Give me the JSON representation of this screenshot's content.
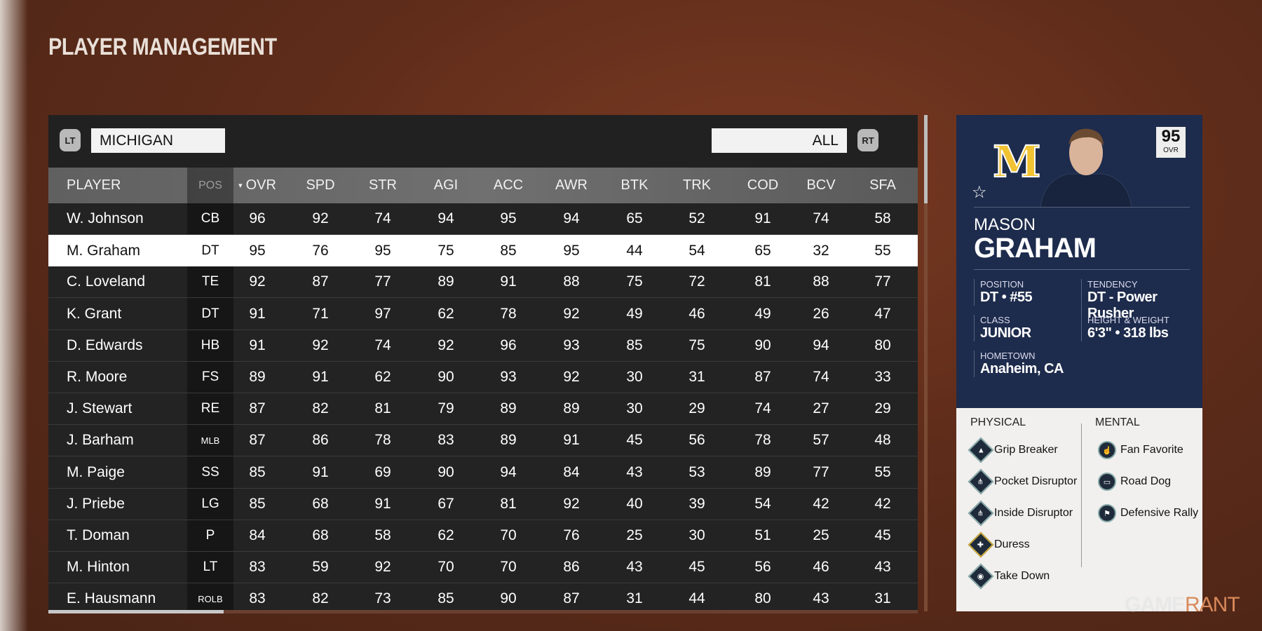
{
  "page_title": "PLAYER MANAGEMENT",
  "filters": {
    "left_bumper": "LT",
    "team": "MICHIGAN",
    "position_filter": "ALL",
    "right_bumper": "RT"
  },
  "table": {
    "columns": [
      "PLAYER",
      "POS",
      "OVR",
      "SPD",
      "STR",
      "AGI",
      "ACC",
      "AWR",
      "BTK",
      "TRK",
      "COD",
      "BCV",
      "SFA"
    ],
    "sort_column": "OVR",
    "sort_indicator": "▾",
    "selected_row": 1,
    "rows": [
      {
        "player": "W. Johnson",
        "pos": "CB",
        "stats": [
          96,
          92,
          74,
          94,
          95,
          94,
          65,
          52,
          91,
          74,
          58
        ]
      },
      {
        "player": "M. Graham",
        "pos": "DT",
        "stats": [
          95,
          76,
          95,
          75,
          85,
          95,
          44,
          54,
          65,
          32,
          55
        ]
      },
      {
        "player": "C. Loveland",
        "pos": "TE",
        "stats": [
          92,
          87,
          77,
          89,
          91,
          88,
          75,
          72,
          81,
          88,
          77
        ]
      },
      {
        "player": "K. Grant",
        "pos": "DT",
        "stats": [
          91,
          71,
          97,
          62,
          78,
          92,
          49,
          46,
          49,
          26,
          47
        ]
      },
      {
        "player": "D. Edwards",
        "pos": "HB",
        "stats": [
          91,
          92,
          74,
          92,
          96,
          93,
          85,
          75,
          90,
          94,
          80
        ]
      },
      {
        "player": "R. Moore",
        "pos": "FS",
        "stats": [
          89,
          91,
          62,
          90,
          93,
          92,
          30,
          31,
          87,
          74,
          33
        ]
      },
      {
        "player": "J. Stewart",
        "pos": "RE",
        "stats": [
          87,
          82,
          81,
          79,
          89,
          89,
          30,
          29,
          74,
          27,
          29
        ]
      },
      {
        "player": "J. Barham",
        "pos": "MLB",
        "stats": [
          87,
          86,
          78,
          83,
          89,
          91,
          45,
          56,
          78,
          57,
          48
        ]
      },
      {
        "player": "M. Paige",
        "pos": "SS",
        "stats": [
          85,
          91,
          69,
          90,
          94,
          84,
          43,
          53,
          89,
          77,
          55
        ]
      },
      {
        "player": "J. Priebe",
        "pos": "LG",
        "stats": [
          85,
          68,
          91,
          67,
          81,
          92,
          40,
          39,
          54,
          42,
          42
        ]
      },
      {
        "player": "T. Doman",
        "pos": "P",
        "stats": [
          84,
          68,
          58,
          62,
          70,
          76,
          25,
          30,
          51,
          25,
          45
        ]
      },
      {
        "player": "M. Hinton",
        "pos": "LT",
        "stats": [
          83,
          59,
          92,
          70,
          70,
          86,
          43,
          45,
          56,
          46,
          43
        ]
      },
      {
        "player": "E. Hausmann",
        "pos": "ROLB",
        "stats": [
          83,
          82,
          73,
          85,
          90,
          87,
          31,
          44,
          80,
          43,
          31
        ]
      }
    ]
  },
  "card": {
    "team_logo": "M",
    "ovr": "95",
    "ovr_label": "OVR",
    "first_name": "MASON",
    "last_name": "GRAHAM",
    "position_label": "POSITION",
    "position": "DT • #55",
    "tendency_label": "TENDENCY",
    "tendency": "DT - Power Rusher",
    "class_label": "CLASS",
    "class": "JUNIOR",
    "hw_label": "HEIGHT & WEIGHT",
    "hw": "6'3\" • 318 lbs",
    "hometown_label": "HOMETOWN",
    "hometown": "Anaheim, CA",
    "physical_label": "PHYSICAL",
    "mental_label": "MENTAL",
    "physical": [
      "Grip Breaker",
      "Pocket Disruptor",
      "Inside Disruptor",
      "Duress",
      "Take Down"
    ],
    "mental": [
      "Fan Favorite",
      "Road Dog",
      "Defensive Rally"
    ],
    "navy": "#1d2b4c",
    "gold": "#f1c232"
  },
  "watermark": {
    "part1": "GAME",
    "part2": "RANT"
  }
}
